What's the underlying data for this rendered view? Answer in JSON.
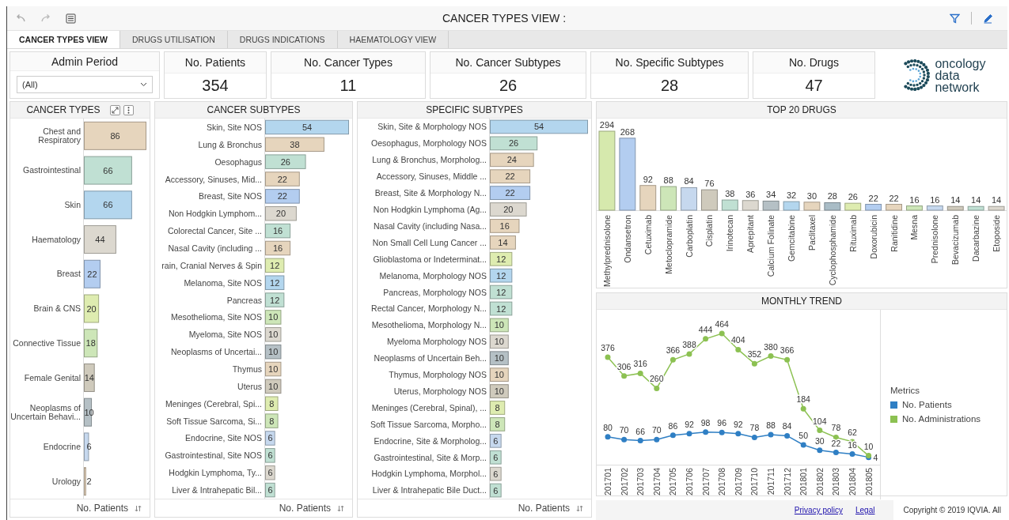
{
  "toolbar": {
    "title": "CANCER TYPES VIEW :"
  },
  "tabs": [
    {
      "label": "CANCER TYPES VIEW",
      "selected": true
    },
    {
      "label": "DRUGS UTILISATION",
      "selected": false
    },
    {
      "label": "DRUGS INDICATIONS",
      "selected": false
    },
    {
      "label": "HAEMATOLOGY VIEW",
      "selected": false
    }
  ],
  "filter": {
    "label": "Admin Period",
    "value": "(All)"
  },
  "kpis": [
    {
      "label": "No. Patients",
      "value": "354"
    },
    {
      "label": "No. Cancer Types",
      "value": "11"
    },
    {
      "label": "No. Cancer Subtypes",
      "value": "26"
    },
    {
      "label": "No. Specific Subtypes",
      "value": "28"
    },
    {
      "label": "No. Drugs",
      "value": "47"
    }
  ],
  "logo": {
    "lines": [
      "oncology",
      "data",
      "network"
    ]
  },
  "cancer_types": {
    "chart_data": {
      "type": "bar",
      "orientation": "horizontal",
      "title": "CANCER TYPES",
      "xlabel": "No. Patients",
      "data_labels": true,
      "categories": [
        "Chest and Respiratory",
        "Gastrointestinal",
        "Skin",
        "Haematology",
        "Breast",
        "Brain & CNS",
        "Connective Tissue",
        "Female Genital",
        "Neoplasms of Uncertain Behavi...",
        "Endocrine",
        "Urology"
      ],
      "values": [
        86,
        66,
        66,
        44,
        22,
        20,
        18,
        14,
        10,
        6,
        2
      ],
      "colors": [
        "#e6d5bd",
        "#c0e0d3",
        "#b3d6ee",
        "#dcd8cf",
        "#b3cdf0",
        "#deecb0",
        "#cde6b8",
        "#cfcabc",
        "#b5c0c5",
        "#c6d8ee",
        "#e6d5bd"
      ]
    }
  },
  "cancer_subtypes": {
    "chart_data": {
      "type": "bar",
      "orientation": "horizontal",
      "title": "CANCER SUBTYPES",
      "xlabel": "No. Patients",
      "data_labels": true,
      "categories": [
        "Skin, Site NOS",
        "Lung & Bronchus",
        "Oesophagus",
        "Accessory, Sinuses, Mid...",
        "Breast, Site NOS",
        "Non Hodgkin Lymphom...",
        "Colorectal Cancer, Site ...",
        "Nasal Cavity (including ...",
        "rain, Cranial Nerves & Spin",
        "Melanoma, Site NOS",
        "Pancreas",
        "Mesothelioma, Site NOS",
        "Myeloma, Site NOS",
        "Neoplasms of Uncertai...",
        "Thymus",
        "Uterus",
        "Meninges (Cerebral, Spi...",
        "Soft Tissue Sarcoma, Si...",
        "Endocrine, Site NOS",
        "Gastrointestinal, Site NOS",
        "Hodgkin Lymphoma, Ty...",
        "Liver & Intrahepatic Bil..."
      ],
      "values": [
        54,
        38,
        26,
        22,
        22,
        20,
        16,
        16,
        12,
        12,
        12,
        10,
        10,
        10,
        10,
        10,
        8,
        8,
        6,
        6,
        6,
        6
      ],
      "colors": [
        "#b3d6ee",
        "#e6d5bd",
        "#c0e0d3",
        "#e6d5bd",
        "#b3cdf0",
        "#dcd8cf",
        "#c0e0d3",
        "#e6d5bd",
        "#deecb0",
        "#b3d6ee",
        "#c0e0d3",
        "#cde6b8",
        "#dcd8cf",
        "#b5c0c5",
        "#e6d5bd",
        "#cfcabc",
        "#deecb0",
        "#cde6b8",
        "#c6d8ee",
        "#c0e0d3",
        "#dcd8cf",
        "#c0e0d3"
      ]
    }
  },
  "specific_subtypes": {
    "chart_data": {
      "type": "bar",
      "orientation": "horizontal",
      "title": "SPECIFIC SUBTYPES",
      "xlabel": "No. Patients",
      "data_labels": true,
      "categories": [
        "Skin, Site & Morphology NOS",
        "Oesophagus, Morphology NOS",
        "Lung & Bronchus, Morpholog...",
        "Accessory, Sinuses, Middle ...",
        "Breast, Site & Morphology N...",
        "Non Hodgkin Lymphoma (Ag...",
        "Nasal Cavity (including Nasa...",
        "Non Small Cell Lung Cancer ...",
        "Glioblastoma or Indeterminat...",
        "Melanoma, Morphology NOS",
        "Pancreas, Morphology NOS",
        "Rectal Cancer, Morphology N...",
        "Mesothelioma, Morphology N...",
        "Myeloma Morphology NOS",
        "Neoplasms of Uncertain Beh...",
        "Thymus, Morphology NOS",
        "Uterus, Morphology NOS",
        "Meninges (Cerebral, Spinal), ...",
        "Soft Tissue Sarcoma, Morpho...",
        "Endocrine, Site & Morpholog...",
        "Gastrointestinal, Site & Morp...",
        "Hodgkin Lymphoma, Morphol...",
        "Liver & Intrahepatic Bile Duct..."
      ],
      "values": [
        54,
        26,
        24,
        22,
        22,
        20,
        16,
        14,
        12,
        12,
        12,
        12,
        10,
        10,
        10,
        10,
        10,
        8,
        8,
        6,
        6,
        6,
        6
      ],
      "colors": [
        "#b3d6ee",
        "#c0e0d3",
        "#e6d5bd",
        "#e6d5bd",
        "#b3cdf0",
        "#dcd8cf",
        "#e6d5bd",
        "#e6d5bd",
        "#deecb0",
        "#b3d6ee",
        "#c0e0d3",
        "#c0e0d3",
        "#cde6b8",
        "#dcd8cf",
        "#b5c0c5",
        "#e6d5bd",
        "#cfcabc",
        "#deecb0",
        "#cde6b8",
        "#c6d8ee",
        "#c0e0d3",
        "#dcd8cf",
        "#c0e0d3"
      ]
    }
  },
  "top_drugs": {
    "chart_data": {
      "type": "bar",
      "orientation": "vertical",
      "title": "TOP 20 DRUGS",
      "data_labels": true,
      "categories": [
        "Methylprednisolone",
        "Ondansetron",
        "Cetuximab",
        "Metoclopramide",
        "Carboplatin",
        "Cisplatin",
        "Irinotecan",
        "Aprepitant",
        "Calcium Folinate",
        "Gemcitabine",
        "Paclitaxel",
        "Cyclophosphamide",
        "Rituximab",
        "Doxorubicin",
        "Ranitidine",
        "Mesna",
        "Prednisolone",
        "Bevacizumab",
        "Dacarbazine",
        "Etoposide"
      ],
      "values": [
        294,
        268,
        92,
        88,
        84,
        76,
        38,
        36,
        34,
        32,
        30,
        28,
        26,
        22,
        22,
        16,
        16,
        14,
        14,
        14
      ],
      "colors": [
        "#d6e9ad",
        "#b3cdf0",
        "#e6d5bd",
        "#cde6b8",
        "#c6d8ee",
        "#cfcabc",
        "#c0e0d3",
        "#dcd8cf",
        "#b5c0c5",
        "#b3d6ee",
        "#e6d5bd",
        "#a9bcc6",
        "#deecb0",
        "#b3cdf0",
        "#e6d5bd",
        "#cde6b8",
        "#c6d8ee",
        "#cfcabc",
        "#c0e0d3",
        "#dcd8cf"
      ]
    }
  },
  "trend": {
    "legend": {
      "title": "Metrics"
    },
    "chart_data": {
      "type": "line",
      "title": "MONTHLY TREND",
      "data_labels": true,
      "x": [
        "201701",
        "201702",
        "201703",
        "201704",
        "201705",
        "201706",
        "201707",
        "201708",
        "201709",
        "201710",
        "201711",
        "201712",
        "201801",
        "201802",
        "201803",
        "201804",
        "201805"
      ],
      "series": [
        {
          "name": "No. Patients",
          "color": "#2f7fc4",
          "marker": true,
          "values": [
            80,
            70,
            66,
            70,
            86,
            92,
            98,
            96,
            92,
            78,
            88,
            84,
            50,
            30,
            22,
            16,
            4
          ]
        },
        {
          "name": "No. Administrations",
          "color": "#8cc152",
          "marker": true,
          "values": [
            376,
            306,
            316,
            260,
            366,
            388,
            444,
            464,
            404,
            352,
            380,
            366,
            184,
            104,
            78,
            62,
            10
          ]
        }
      ]
    }
  },
  "footer": {
    "links": [
      "Privacy policy",
      "Legal"
    ],
    "copyright": "Copyright © 2019 IQVIA. All"
  }
}
